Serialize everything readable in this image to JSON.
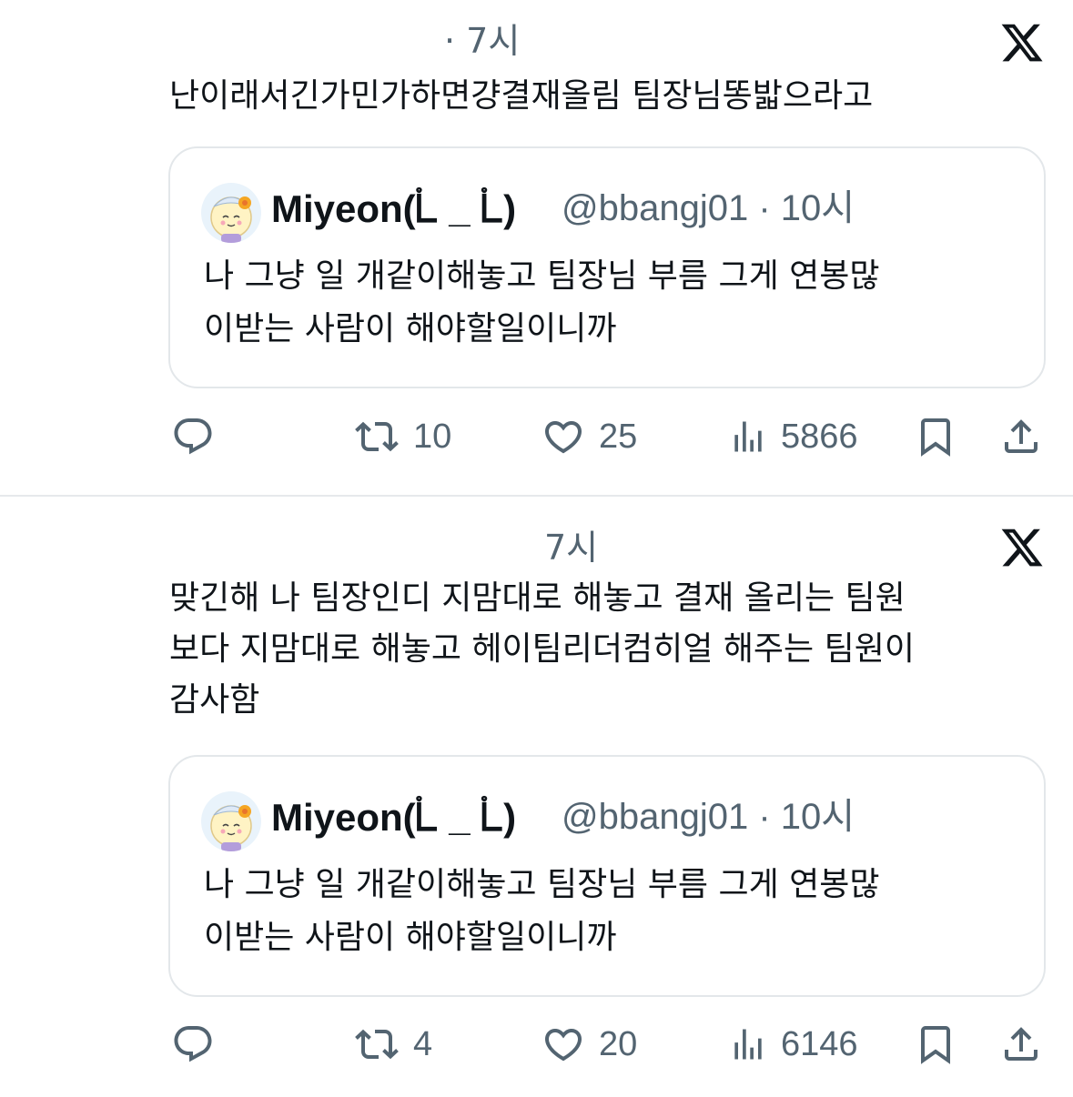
{
  "tweets": [
    {
      "time": "· 7시",
      "text": "난이래서긴가민가하면걍결재올림 팀장님똥밟으라고",
      "quote": {
        "name": "Miyeon(ᢺ _ ᢺ)",
        "handle": "@bbangj01 · 10시",
        "text": "나 그냥 일 개같이해놓고 팀장님 부름 그게 연봉많\n이받는 사람이 해야할일이니까"
      },
      "stats": {
        "retweets": "10",
        "likes": "25",
        "views": "5866"
      }
    },
    {
      "time": "7시",
      "text": "맞긴해 나 팀장인디 지맘대로 해놓고 결재 올리는 팀원\n보다 지맘대로 해놓고 헤이팀리더컴히얼 해주는 팀원이\n감사함",
      "quote": {
        "name": "Miyeon(ᢺ _ ᢺ)",
        "handle": "@bbangj01 · 10시",
        "text": "나 그냥 일 개같이해놓고 팀장님 부름 그게 연봉많\n이받는 사람이 해야할일이니까"
      },
      "stats": {
        "retweets": "4",
        "likes": "20",
        "views": "6146"
      }
    }
  ],
  "icons": {
    "logo": "x-logo-icon",
    "reply": "reply-icon",
    "retweet": "retweet-icon",
    "like": "heart-icon",
    "views": "views-icon",
    "bookmark": "bookmark-icon",
    "share": "share-icon"
  },
  "colors": {
    "text": "#0f1419",
    "secondary": "#536471",
    "border": "#e3e7ea"
  }
}
